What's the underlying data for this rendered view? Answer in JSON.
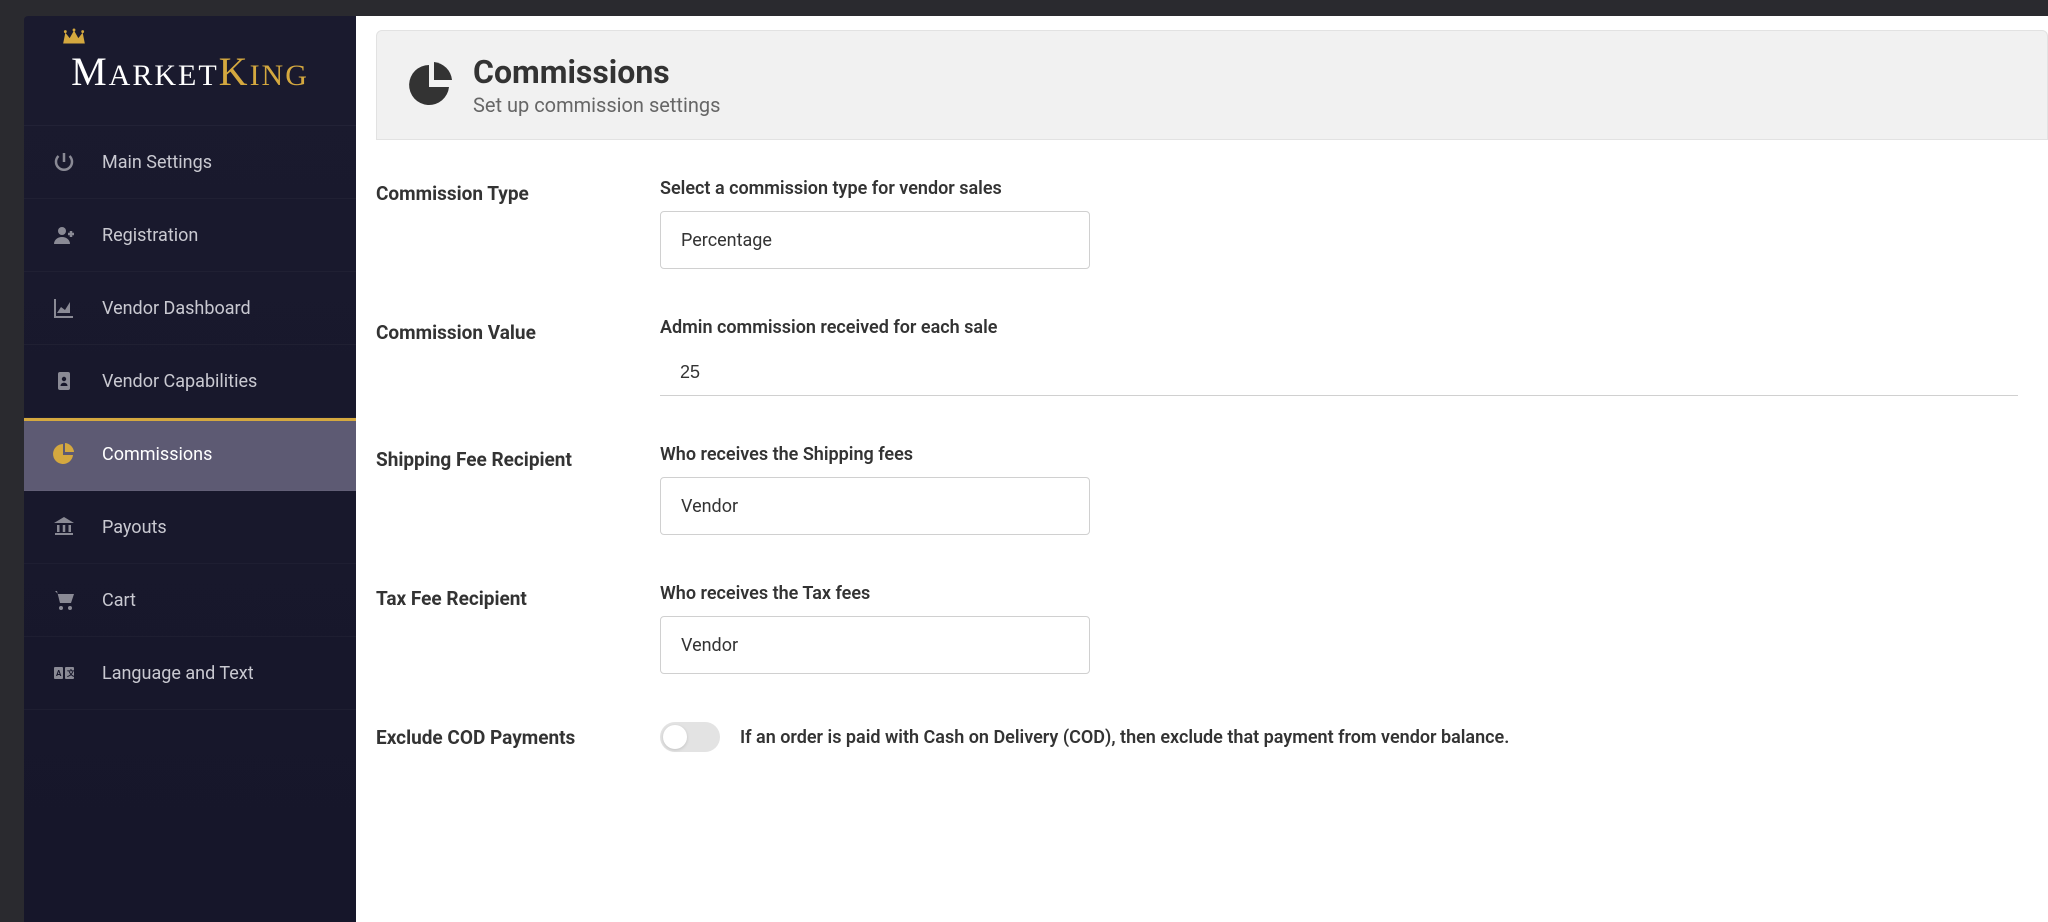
{
  "brand": {
    "part1": "ARKET",
    "part2": "ING"
  },
  "sidebar": {
    "items": [
      {
        "label": "Main Settings"
      },
      {
        "label": "Registration"
      },
      {
        "label": "Vendor Dashboard"
      },
      {
        "label": "Vendor Capabilities"
      },
      {
        "label": "Commissions"
      },
      {
        "label": "Payouts"
      },
      {
        "label": "Cart"
      },
      {
        "label": "Language and Text"
      }
    ]
  },
  "header": {
    "title": "Commissions",
    "subtitle": "Set up commission settings"
  },
  "form": {
    "commission_type": {
      "label": "Commission Type",
      "help": "Select a commission type for vendor sales",
      "value": "Percentage"
    },
    "commission_value": {
      "label": "Commission Value",
      "help": "Admin commission received for each sale",
      "value": "25"
    },
    "shipping_fee": {
      "label": "Shipping Fee Recipient",
      "help": "Who receives the Shipping fees",
      "value": "Vendor"
    },
    "tax_fee": {
      "label": "Tax Fee Recipient",
      "help": "Who receives the Tax fees",
      "value": "Vendor"
    },
    "exclude_cod": {
      "label": "Exclude COD Payments",
      "desc": "If an order is paid with Cash on Delivery (COD), then exclude that payment from vendor balance."
    }
  }
}
